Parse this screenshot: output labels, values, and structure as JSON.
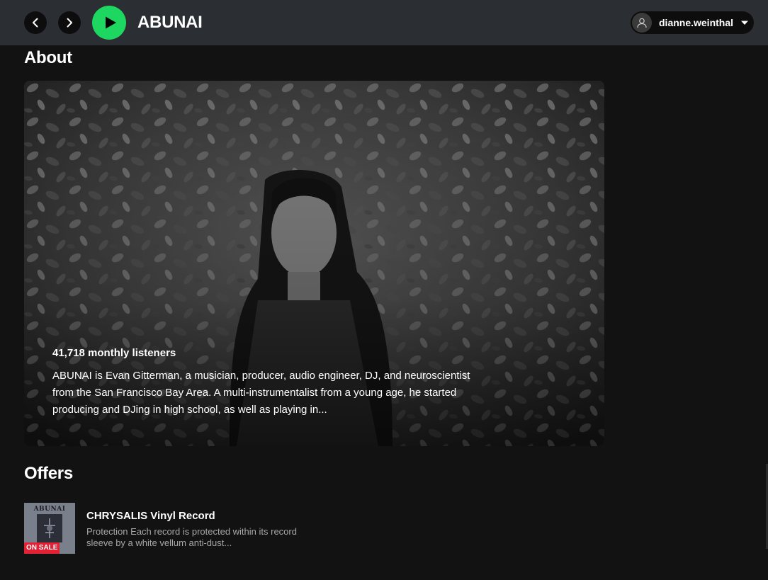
{
  "header": {
    "artist_name": "ABUNAI",
    "username": "dianne.weinthal",
    "icons": {
      "back": "chevron-left-icon",
      "forward": "chevron-right-icon",
      "play": "play-icon",
      "user": "user-icon",
      "dropdown": "caret-down-icon"
    }
  },
  "about": {
    "heading": "About",
    "monthly_listeners": "41,718 monthly listeners",
    "bio": "ABUNAI is Evan Gitterman, a musician, producer, audio engineer, DJ, and neuroscientist from the San Francisco Bay Area. A multi-instrumentalist from a young age, he started producing and DJing in high school, as well as playing in..."
  },
  "offers": {
    "heading": "Offers",
    "items": [
      {
        "art_text": "ABUNAI",
        "badge": "ON SALE",
        "title": "CHRYSALIS Vinyl Record",
        "description": "Protection Each record is protected within its record sleeve by a white vellum anti-dust..."
      }
    ]
  },
  "colors": {
    "accent": "#1ed760",
    "background": "#121212",
    "topbar": "#2b2e32",
    "sale": "#e22134"
  }
}
